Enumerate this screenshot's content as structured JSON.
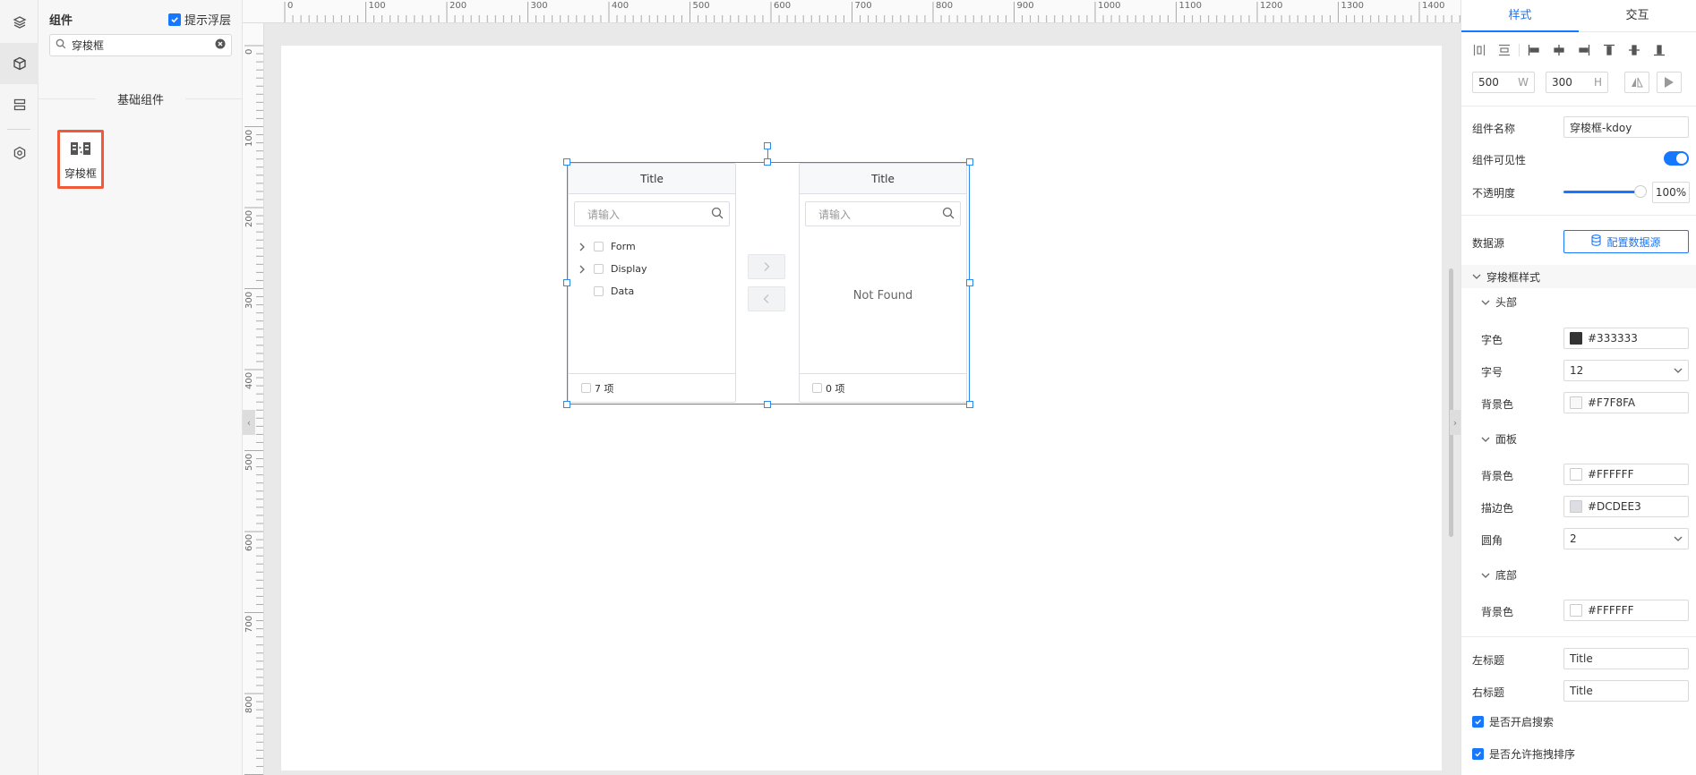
{
  "left_panel": {
    "title": "组件",
    "hint_label": "提示浮层",
    "search_value": "穿梭框",
    "category": "基础组件",
    "component_label": "穿梭框"
  },
  "ruler": {
    "h_labels": [
      "0",
      "100",
      "200",
      "300",
      "400",
      "500",
      "600",
      "700",
      "800",
      "900",
      "1000",
      "1100",
      "1200",
      "1300",
      "1400"
    ],
    "v_labels": [
      "0",
      "100",
      "200",
      "300",
      "400",
      "500",
      "600",
      "700",
      "800"
    ]
  },
  "transfer": {
    "left_title": "Title",
    "right_title": "Title",
    "search_placeholder": "请输入",
    "items": [
      "Form",
      "Display",
      "Data"
    ],
    "left_count": "7 项",
    "right_count": "0 项",
    "empty_text": "Not Found"
  },
  "props": {
    "tab_style": "样式",
    "tab_interact": "交互",
    "width": "500",
    "width_unit": "W",
    "height": "300",
    "height_unit": "H",
    "name_label": "组件名称",
    "name_value": "穿梭框-kdoy",
    "visible_label": "组件可见性",
    "visible": true,
    "opacity_label": "不透明度",
    "opacity_value": "100%",
    "datasource_label": "数据源",
    "datasource_button": "配置数据源",
    "section_title": "穿梭框样式",
    "header_group": "头部",
    "font_color_label": "字色",
    "font_color_value": "#333333",
    "font_size_label": "字号",
    "font_size_value": "12",
    "header_bg_label": "背景色",
    "header_bg_value": "#F7F8FA",
    "panel_group": "面板",
    "panel_bg_label": "背景色",
    "panel_bg_value": "#FFFFFF",
    "border_color_label": "描边色",
    "border_color_value": "#DCDEE3",
    "radius_label": "圆角",
    "radius_value": "2",
    "footer_group": "底部",
    "footer_bg_label": "背景色",
    "footer_bg_value": "#FFFFFF",
    "left_title_label": "左标题",
    "left_title_value": "Title",
    "right_title_label": "右标题",
    "right_title_value": "Title",
    "search_enabled_label": "是否开启搜索",
    "search_enabled": true,
    "drag_sort_label": "是否允许拖拽排序",
    "drag_sort": true
  },
  "colors": {
    "accent": "#1677ff",
    "selection": "#2d8cf0",
    "highlight_border": "#f05a38",
    "swatch_font": "#333333",
    "swatch_header_bg": "#F7F8FA",
    "swatch_panel_bg": "#FFFFFF",
    "swatch_border": "#DCDEE3",
    "swatch_footer_bg": "#FFFFFF"
  }
}
